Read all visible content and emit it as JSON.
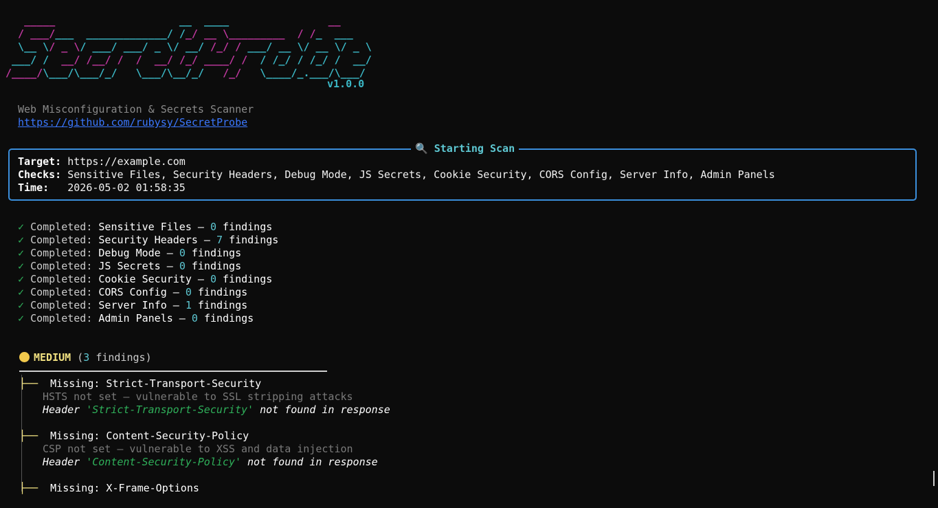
{
  "logo_lines": [
    {
      "m1": "   _____",
      "c1": "",
      "m2": "                    __",
      "c2": "  ____",
      "m3": "                __"
    },
    {
      "m1": "  / ___/",
      "c1": "___  _____________/ /",
      "m2": "_/ __ \\_________  / /",
      "c2": "_  ___",
      "m3": ""
    },
    {
      "m1": "  \\__ \\/ _ \\/ ___/ ___/ _ \\/ __/ /_/ / ___/ __ \\/ __ \\/ _ \\",
      "c1": "",
      "m2": "",
      "c2": "",
      "m3": ""
    },
    {
      "m1": " ___/ /  __/ /__/ /  /  __/ /_/ ____/ /  / /_/ / /_/ /  __/",
      "c1": "",
      "m2": "",
      "c2": "",
      "m3": ""
    },
    {
      "m1": "/____/",
      "c1": "\\___/\\___/_/   \\___/\\__/_/   /_/   \\____/_.___/\\___/",
      "m2": "",
      "c2": "",
      "m3": ""
    }
  ],
  "version": "v1.0.0",
  "tagline": "Web Misconfiguration & Secrets Scanner",
  "repo_url": "https://github.com/rubysy/SecretProbe",
  "panel": {
    "icon": "magnifier-icon",
    "title": "Starting Scan",
    "target_label": "Target:",
    "target_value": "https://example.com",
    "checks_label": "Checks:",
    "checks_value": "Sensitive Files, Security Headers, Debug Mode, JS Secrets, Cookie Security, CORS Config, Server Info, Admin Panels",
    "time_label": "Time:",
    "time_value": "2026-05-02 01:58:35"
  },
  "completed": [
    {
      "check": "✓",
      "label": "Completed:",
      "name": "Sensitive Files",
      "count": "0",
      "suffix": "findings"
    },
    {
      "check": "✓",
      "label": "Completed:",
      "name": "Security Headers",
      "count": "7",
      "suffix": "findings"
    },
    {
      "check": "✓",
      "label": "Completed:",
      "name": "Debug Mode",
      "count": "0",
      "suffix": "findings"
    },
    {
      "check": "✓",
      "label": "Completed:",
      "name": "JS Secrets",
      "count": "0",
      "suffix": "findings"
    },
    {
      "check": "✓",
      "label": "Completed:",
      "name": "Cookie Security",
      "count": "0",
      "suffix": "findings"
    },
    {
      "check": "✓",
      "label": "Completed:",
      "name": "CORS Config",
      "count": "0",
      "suffix": "findings"
    },
    {
      "check": "✓",
      "label": "Completed:",
      "name": "Server Info",
      "count": "1",
      "suffix": "findings"
    },
    {
      "check": "✓",
      "label": "Completed:",
      "name": "Admin Panels",
      "count": "0",
      "suffix": "findings"
    }
  ],
  "severity": {
    "icon": "yellow-circle-icon",
    "label": "MEDIUM",
    "count": "3",
    "count_suffix": "findings"
  },
  "findings": [
    {
      "tree": "├──",
      "title": "Missing: Strict-Transport-Security",
      "description": "HSTS not set — vulnerable to SSL stripping attacks",
      "evidence_prefix": "Header ",
      "evidence_quoted": "'Strict-Transport-Security'",
      "evidence_suffix": " not found in response"
    },
    {
      "tree": "├──",
      "title": "Missing: Content-Security-Policy",
      "description": "CSP not set — vulnerable to XSS and data injection",
      "evidence_prefix": "Header ",
      "evidence_quoted": "'Content-Security-Policy'",
      "evidence_suffix": " not found in response"
    },
    {
      "tree": "├──",
      "title": "Missing: X-Frame-Options",
      "description": "",
      "evidence_prefix": "",
      "evidence_quoted": "",
      "evidence_suffix": ""
    }
  ],
  "colors": {
    "background": "#0c0c0c",
    "logo_magenta": "#c0389f",
    "logo_cyan": "#3bb8c6",
    "panel_border": "#3b8edb",
    "success_green": "#2fb05a",
    "severity_yellow": "#f2c94c"
  }
}
